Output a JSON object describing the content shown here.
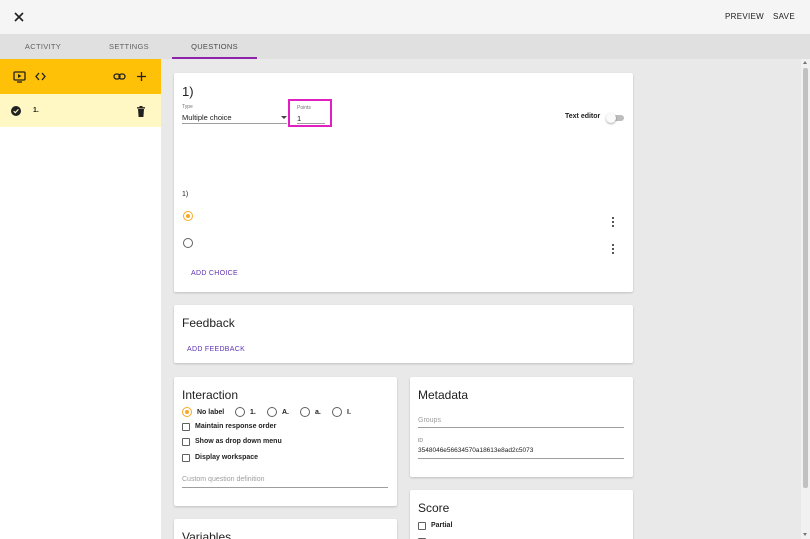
{
  "topbar": {
    "close_icon": "close-icon",
    "preview_label": "PREVIEW",
    "save_label": "SAVE"
  },
  "tabs": [
    {
      "label": "ACTIVITY",
      "active": false
    },
    {
      "label": "SETTINGS",
      "active": false
    },
    {
      "label": "QUESTIONS",
      "active": true
    }
  ],
  "colors": {
    "accent": "#ffc107",
    "selected_item_bg": "#fff8c4",
    "tab_indicator": "#8e24aa",
    "highlight_box": "#e020c0",
    "link": "#5e35b1",
    "radio_selected": "#f9a825"
  },
  "sidebar": {
    "header_icons": [
      "preview-icon",
      "code-icon",
      "link-icon",
      "plus-icon"
    ],
    "items": [
      {
        "label": "1.",
        "status_icon": "check-circle-icon",
        "action_icon": "trash-icon"
      }
    ]
  },
  "question": {
    "title": "1)",
    "type_label": "Type",
    "type_value": "Multiple choice",
    "points_label": "Points",
    "points_value": "1",
    "text_editor_label": "Text editor",
    "text_editor_on": false,
    "prompt_number": "1)",
    "choices": [
      {
        "selected": true
      },
      {
        "selected": false
      }
    ],
    "add_choice_label": "ADD CHOICE"
  },
  "feedback": {
    "title": "Feedback",
    "add_feedback_label": "ADD FEEDBACK"
  },
  "interaction": {
    "title": "Interaction",
    "label_options": [
      {
        "label": "No label",
        "selected": true
      },
      {
        "label": "1.",
        "selected": false
      },
      {
        "label": "A.",
        "selected": false
      },
      {
        "label": "a.",
        "selected": false
      },
      {
        "label": "I.",
        "selected": false
      }
    ],
    "checkboxes": [
      {
        "label": "Maintain response order",
        "checked": false
      },
      {
        "label": "Show as drop down menu",
        "checked": false
      },
      {
        "label": "Display workspace",
        "checked": false
      }
    ],
    "custom_definition_placeholder": "Custom question definition"
  },
  "metadata": {
    "title": "Metadata",
    "groups_placeholder": "Groups",
    "id_label": "ID",
    "id_value": "3548046e56634570a18613e8ad2c5073"
  },
  "variables": {
    "title": "Variables"
  },
  "score": {
    "title": "Score",
    "partial_label": "Partial",
    "partial_checked": false
  }
}
